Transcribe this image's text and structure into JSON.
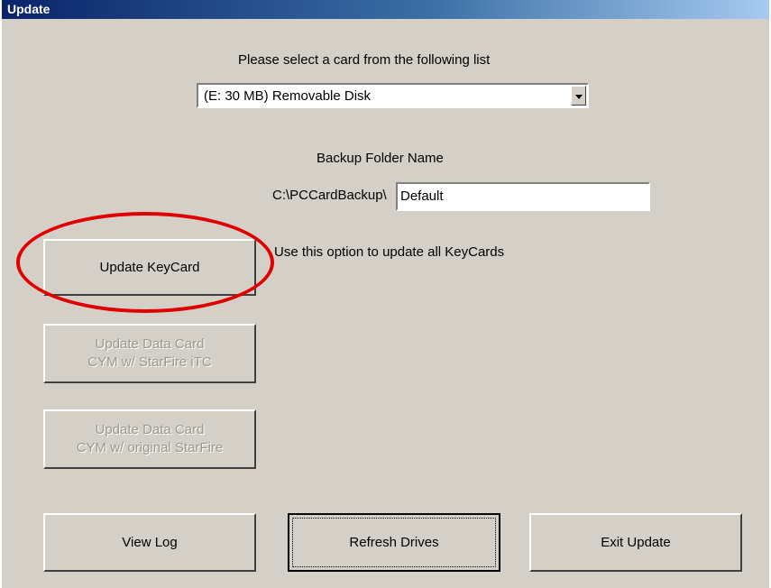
{
  "window": {
    "title": "Update"
  },
  "card_select": {
    "prompt": "Please select a card from the following list",
    "selected": "(E: 30 MB) Removable Disk"
  },
  "backup": {
    "heading": "Backup Folder Name",
    "path_prefix": "C:\\PCCardBackup\\",
    "folder_value": "Default"
  },
  "buttons": {
    "update_keycard": "Update KeyCard",
    "update_keycard_hint": "Use this option to update all KeyCards",
    "update_data_itc_line1": "Update Data Card",
    "update_data_itc_line2": "CYM w/ StarFire iTC",
    "update_data_orig_line1": "Update Data Card",
    "update_data_orig_line2": "CYM w/ original StarFire",
    "view_log": "View Log",
    "refresh_drives": "Refresh Drives",
    "exit_update": "Exit Update"
  },
  "colors": {
    "highlight_ellipse": "#e00000",
    "title_bar": "#0a246a",
    "face": "#d4d0c8"
  }
}
